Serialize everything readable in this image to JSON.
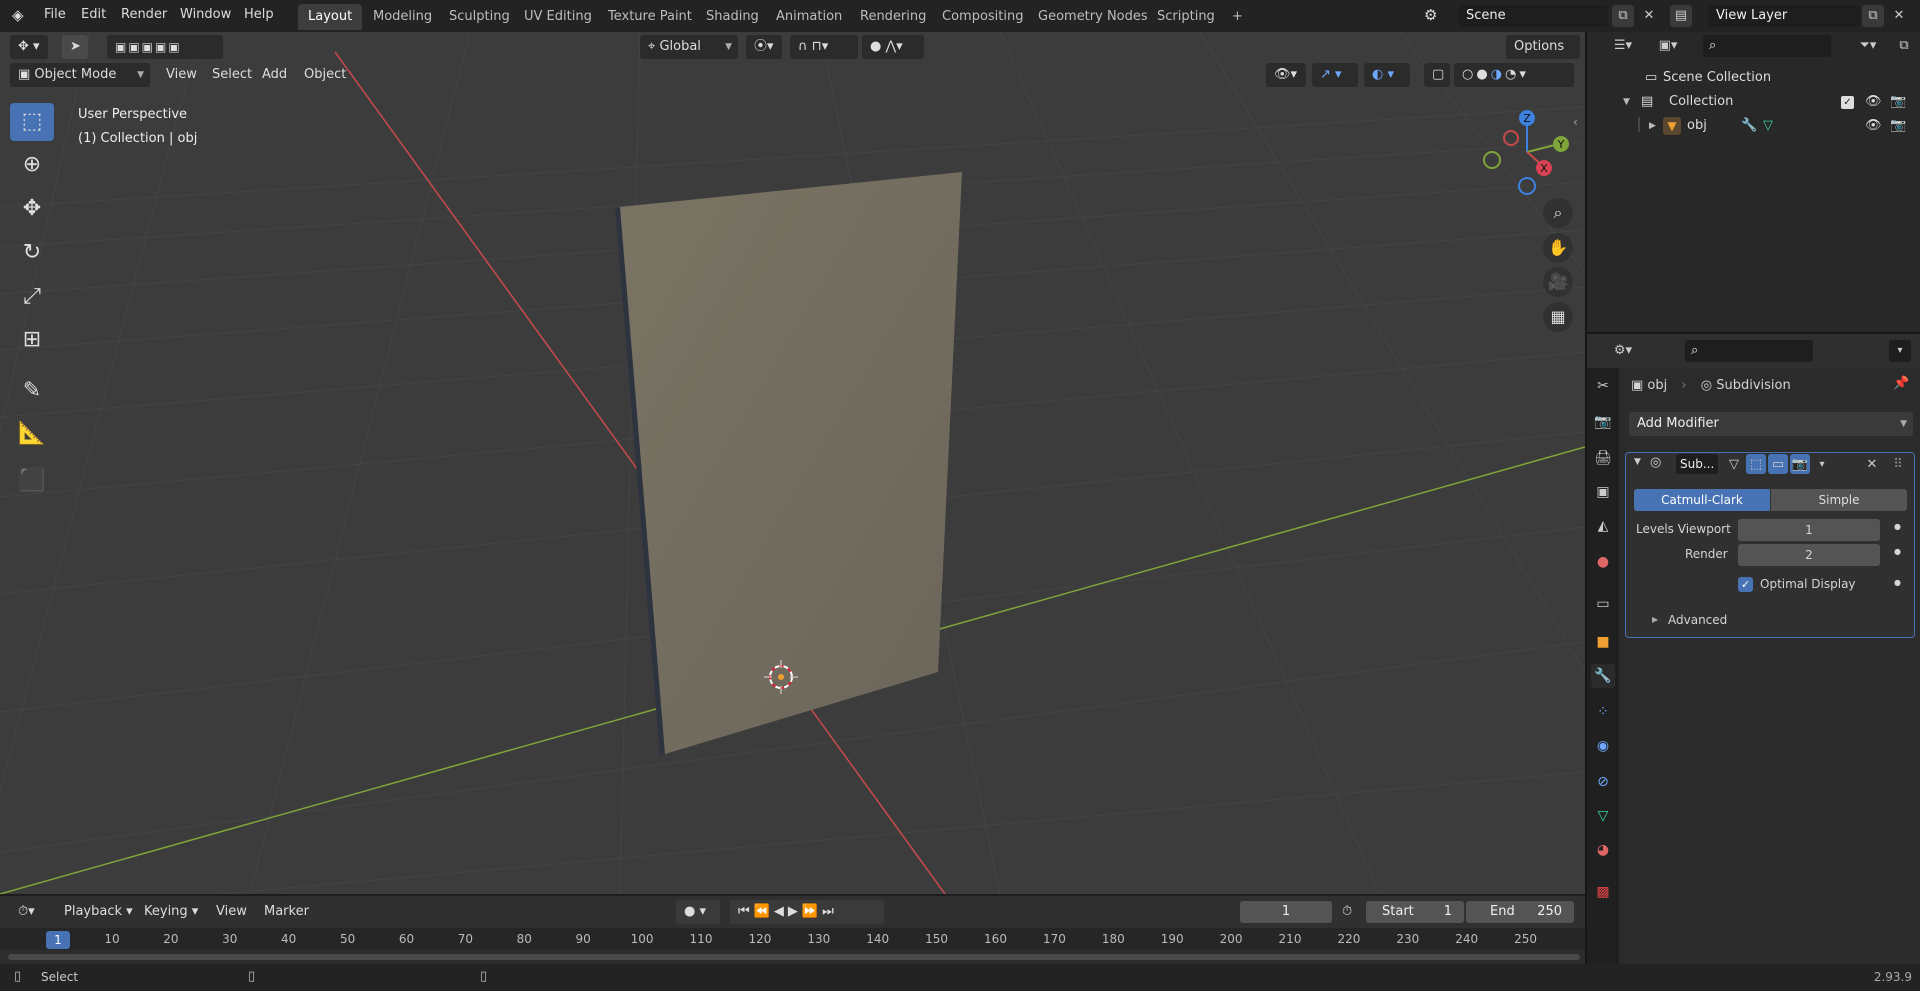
{
  "topbar": {
    "menus": [
      "File",
      "Edit",
      "Render",
      "Window",
      "Help"
    ],
    "workspaces": [
      "Layout",
      "Modeling",
      "Sculpting",
      "UV Editing",
      "Texture Paint",
      "Shading",
      "Animation",
      "Rendering",
      "Compositing",
      "Geometry Nodes",
      "Scripting"
    ],
    "add_tab": "+",
    "scene": "Scene",
    "view_layer": "View Layer"
  },
  "viewport": {
    "transform_orientation": "Global",
    "options_label": "Options",
    "mode": "Object Mode",
    "header_menus": [
      "View",
      "Select",
      "Add",
      "Object"
    ],
    "overlay_title": "User Perspective",
    "overlay_subtitle": "(1) Collection | obj",
    "gizmo": {
      "x": "X",
      "y": "Y",
      "z": "Z"
    }
  },
  "outliner": {
    "scene_collection": "Scene Collection",
    "collection": "Collection",
    "object": "obj"
  },
  "properties": {
    "object_name": "obj",
    "modifier_breadcrumb": "Subdivision",
    "add_modifier": "Add Modifier",
    "modifier_name": "Sub...",
    "subdiv_types": [
      "Catmull-Clark",
      "Simple"
    ],
    "active_type": "Catmull-Clark",
    "levels_viewport_label": "Levels Viewport",
    "levels_viewport": "1",
    "render_label": "Render",
    "render_levels": "2",
    "optimal_display_label": "Optimal Display",
    "optimal_display": true,
    "advanced_label": "Advanced"
  },
  "timeline": {
    "menus": [
      "Playback",
      "Keying",
      "View",
      "Marker"
    ],
    "current_frame": "1",
    "start_label": "Start",
    "start": "1",
    "end_label": "End",
    "end": "250",
    "ruler_current": "1",
    "ruler_ticks": [
      "10",
      "20",
      "30",
      "40",
      "50",
      "60",
      "70",
      "80",
      "90",
      "100",
      "110",
      "120",
      "130",
      "140",
      "150",
      "160",
      "170",
      "180",
      "190",
      "200",
      "210",
      "220",
      "230",
      "240",
      "250"
    ]
  },
  "status": {
    "select_label": "Select",
    "version": "2.93.9"
  },
  "colors": {
    "accent": "#4772b3",
    "viewport_bg": "#3c3c3c",
    "x_axis": "#c84a4a",
    "y_axis": "#7fa53a",
    "z_axis": "#3d82e0"
  }
}
